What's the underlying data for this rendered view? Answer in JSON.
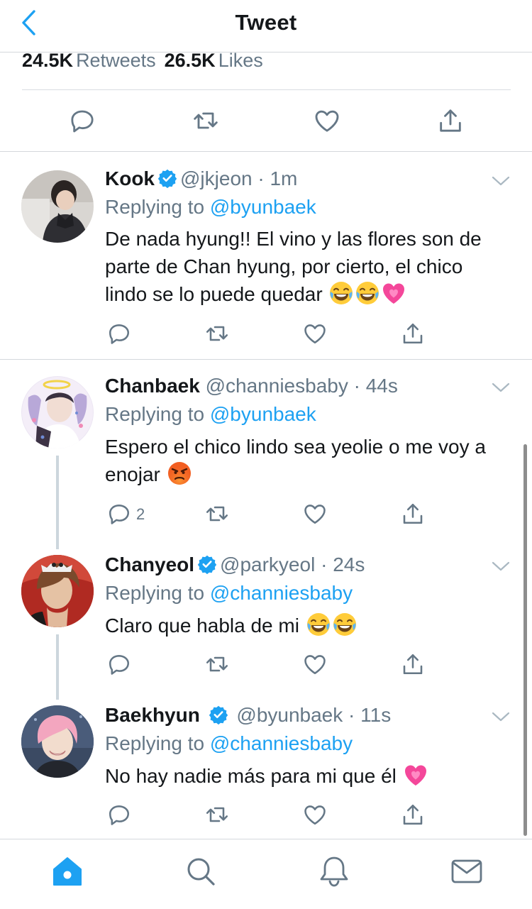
{
  "header": {
    "title": "Tweet",
    "back_icon": "chevron-left-icon"
  },
  "stats": {
    "retweets_count": "24.5K",
    "retweets_label": "Retweets",
    "likes_count": "26.5K",
    "likes_label": "Likes"
  },
  "colors": {
    "accent": "#1da1f2",
    "secondary_text": "#657786",
    "divider": "#d4d8dc"
  },
  "tweets": [
    {
      "name": "Kook",
      "verified": true,
      "handle": "@jkjeon",
      "time": "1m",
      "reply_prefix": "Replying to",
      "reply_to": "@byunbaek",
      "text": "De nada hyung!! El vino y las flores son de parte de Chan hyung, por cierto, el chico lindo se lo puede quedar",
      "emojis": [
        "joy",
        "joy",
        "growing-heart"
      ],
      "reply_count": ""
    },
    {
      "name": "Chanbaek",
      "verified": false,
      "handle": "@channiesbaby",
      "time": "44s",
      "reply_prefix": "Replying to",
      "reply_to": "@byunbaek",
      "text": "Espero el chico lindo sea yeolie o me voy a enojar",
      "emojis": [
        "angry"
      ],
      "reply_count": "2"
    },
    {
      "name": "Chanyeol",
      "verified": true,
      "handle": "@parkyeol",
      "time": "24s",
      "reply_prefix": "Replying to",
      "reply_to": "@channiesbaby",
      "text": "Claro que habla de mi",
      "emojis": [
        "joy",
        "joy"
      ],
      "reply_count": ""
    },
    {
      "name": "Baekhyun",
      "verified": true,
      "handle": "@byunbaek",
      "time": "11s",
      "reply_prefix": "Replying to",
      "reply_to": "@channiesbaby",
      "text": "No hay nadie más para mi que él",
      "emojis": [
        "growing-heart"
      ],
      "reply_count": ""
    }
  ],
  "bottom_nav": [
    "home-icon",
    "search-icon",
    "notifications-icon",
    "messages-icon"
  ]
}
